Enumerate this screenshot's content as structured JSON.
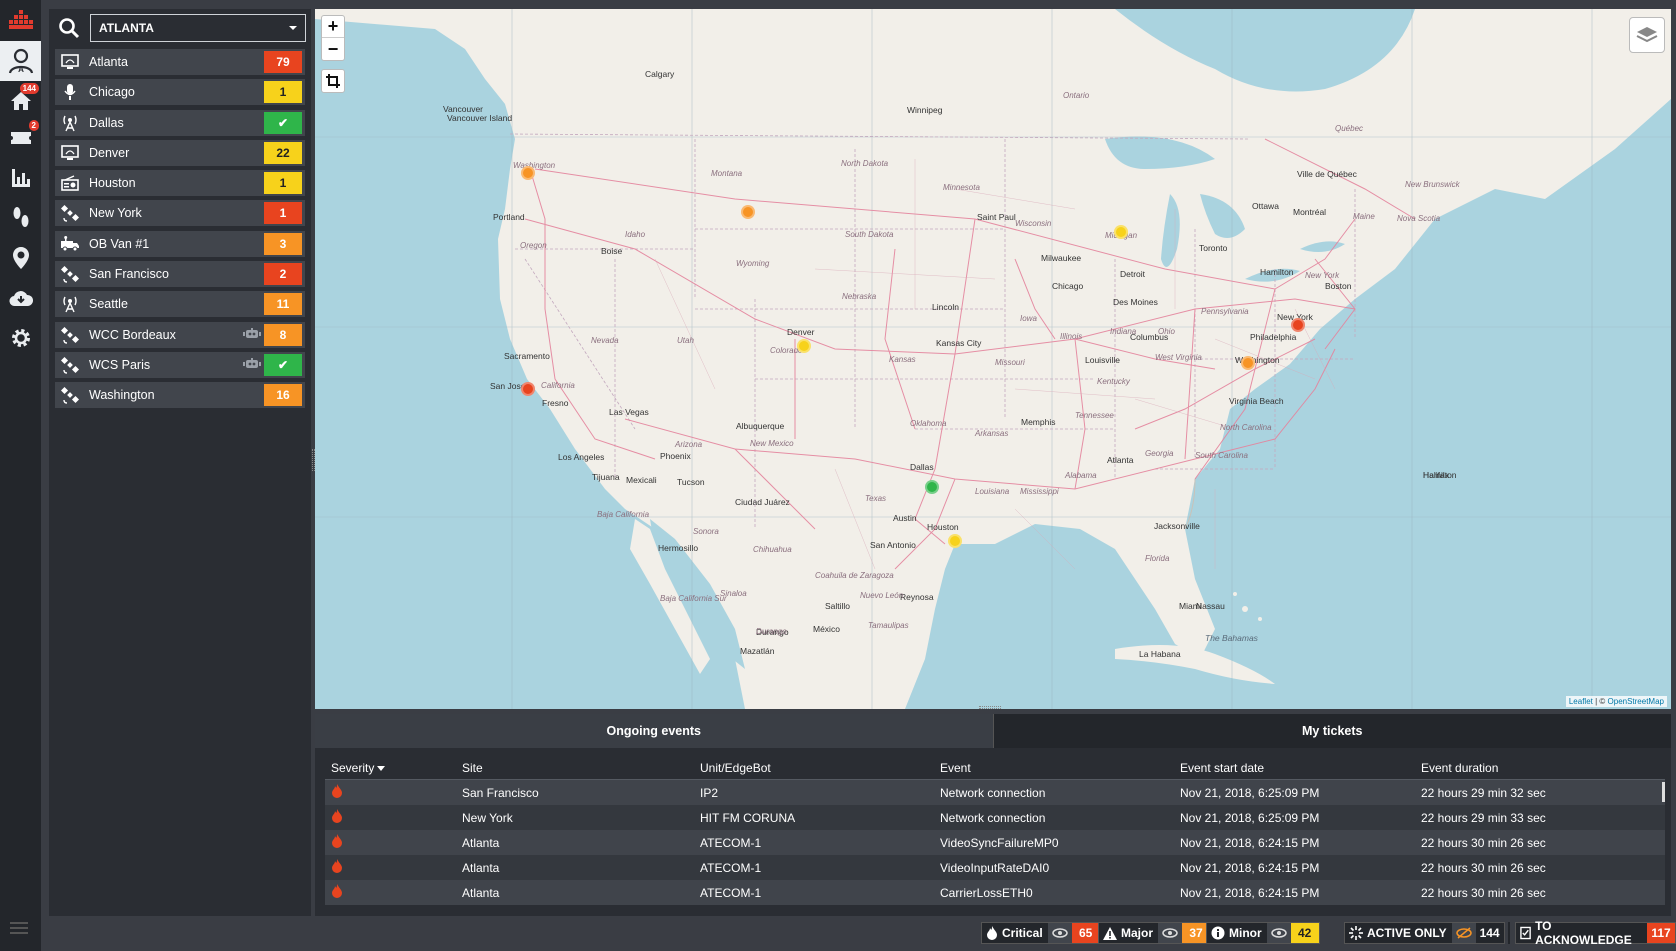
{
  "nav": {
    "items": [
      {
        "icon": "logo-icon"
      },
      {
        "icon": "user-icon"
      },
      {
        "icon": "home-icon",
        "badge": "144"
      },
      {
        "icon": "ticket-icon",
        "badge": "2"
      },
      {
        "icon": "bar-chart-icon"
      },
      {
        "icon": "footsteps-icon"
      },
      {
        "icon": "location-pin-icon"
      },
      {
        "icon": "cloud-download-icon"
      },
      {
        "icon": "gear-icon"
      }
    ]
  },
  "site_panel": {
    "selected_site": "ATLANTA",
    "sites": [
      {
        "name": "Atlanta",
        "icon": "monitor-icon",
        "count": "79",
        "color": "#e8441f",
        "robot": false
      },
      {
        "name": "Chicago",
        "icon": "microphone-icon",
        "count": "1",
        "color": "#f7d21b",
        "robot": false
      },
      {
        "name": "Dallas",
        "icon": "antenna-icon",
        "count": "✔",
        "color": "#2fb54a",
        "robot": false
      },
      {
        "name": "Denver",
        "icon": "monitor-icon",
        "count": "22",
        "color": "#f7d21b",
        "robot": false
      },
      {
        "name": "Houston",
        "icon": "radio-icon",
        "count": "1",
        "color": "#f7d21b",
        "robot": false
      },
      {
        "name": "New York",
        "icon": "satellite-icon",
        "count": "1",
        "color": "#e8441f",
        "robot": false
      },
      {
        "name": "OB Van #1",
        "icon": "van-icon",
        "count": "3",
        "color": "#f79425",
        "robot": false
      },
      {
        "name": "San Francisco",
        "icon": "satellite-icon",
        "count": "2",
        "color": "#e8441f",
        "robot": false
      },
      {
        "name": "Seattle",
        "icon": "antenna-icon",
        "count": "11",
        "color": "#f79425",
        "robot": false
      },
      {
        "name": "WCC Bordeaux",
        "icon": "satellite-icon",
        "count": "8",
        "color": "#f79425",
        "robot": true
      },
      {
        "name": "WCS Paris",
        "icon": "satellite-icon",
        "count": "✔",
        "color": "#2fb54a",
        "robot": true
      },
      {
        "name": "Washington",
        "icon": "satellite-icon",
        "count": "16",
        "color": "#f79425",
        "robot": false
      }
    ]
  },
  "map": {
    "zoom_in": "+",
    "zoom_out": "−",
    "attribution_leaflet": "Leaflet",
    "attribution_sep": " | © ",
    "attribution_osm": "OpenStreetMap",
    "cities": [
      "Calgary",
      "Winnipeg",
      "Vancouver",
      "Vancouver Island",
      "Portland",
      "Boise",
      "Saint Paul",
      "Milwaukee",
      "Detroit",
      "Toronto",
      "Ottawa",
      "Montréal",
      "Ville de Québec",
      "Hamilton",
      "Chicago",
      "Des Moines",
      "Lincoln",
      "Kansas City",
      "Denver",
      "Sacramento",
      "San Jose",
      "Fresno",
      "Las Vegas",
      "Los Angeles",
      "Tijuana",
      "Mexicali",
      "Phoenix",
      "Tucson",
      "Albuquerque",
      "Ciudad Juárez",
      "Dallas",
      "Austin",
      "San Antonio",
      "Houston",
      "Memphis",
      "Atlanta",
      "Louisville",
      "Columbus",
      "Philadelphia",
      "New York",
      "Boston",
      "Washington",
      "Virginia Beach",
      "Jacksonville",
      "Miami",
      "Nassau",
      "Hermosillo",
      "Saltillo",
      "Reynosa",
      "Durango",
      "Mazatlán",
      "México",
      "La Habana",
      "Halifax",
      "Hamilton"
    ],
    "regions": [
      "Washington",
      "Montana",
      "North Dakota",
      "Minnesota",
      "Wisconsin",
      "South Dakota",
      "Wyoming",
      "Nebraska",
      "Oregon",
      "Idaho",
      "Nevada",
      "Utah",
      "Colorado",
      "Kansas",
      "Missouri",
      "Iowa",
      "Illinois",
      "Indiana",
      "Ohio",
      "Kentucky",
      "West Virginia",
      "Pennsylvania",
      "New York",
      "Maine",
      "New Brunswick",
      "Nova Scotia",
      "Ontario",
      "Québec",
      "California",
      "Arizona",
      "New Mexico",
      "Texas",
      "Oklahoma",
      "Arkansas",
      "Tennessee",
      "Alabama",
      "Louisiana",
      "Mississippi",
      "Georgia",
      "North Carolina",
      "South Carolina",
      "Florida",
      "Baja California",
      "Baja California Sur",
      "Sonora",
      "Chihuahua",
      "Coahuila de Zaragoza",
      "Nuevo León",
      "Tamaulipas",
      "Sinaloa",
      "Durango",
      "Michigan"
    ],
    "seas": [
      "The Bahamas"
    ],
    "markers": [
      {
        "site": "Seattle",
        "color": "#f79425"
      },
      {
        "site": "Montana",
        "color": "#f79425"
      },
      {
        "site": "Michigan",
        "color": "#f7d21b"
      },
      {
        "site": "New York",
        "color": "#e8441f"
      },
      {
        "site": "Washington",
        "color": "#f79425"
      },
      {
        "site": "Denver",
        "color": "#f7d21b"
      },
      {
        "site": "San Francisco",
        "color": "#e8441f"
      },
      {
        "site": "Dallas",
        "color": "#2fb54a"
      },
      {
        "site": "Houston",
        "color": "#f7d21b"
      }
    ]
  },
  "events": {
    "tabs": [
      {
        "label": "Ongoing events",
        "active": true
      },
      {
        "label": "My tickets",
        "active": false
      }
    ],
    "columns": [
      "Severity",
      "Site",
      "Unit/EdgeBot",
      "Event",
      "Event start date",
      "Event duration"
    ],
    "rows": [
      {
        "severity": "critical",
        "site": "San Francisco",
        "unit": "IP2",
        "event": "Network connection",
        "start": "Nov 21, 2018, 6:25:09 PM",
        "duration": "22 hours 29 min 32 sec"
      },
      {
        "severity": "critical",
        "site": "New York",
        "unit": "HIT FM CORUNA",
        "event": "Network connection",
        "start": "Nov 21, 2018, 6:25:09 PM",
        "duration": "22 hours 29 min 33 sec"
      },
      {
        "severity": "critical",
        "site": "Atlanta",
        "unit": "ATECOM-1",
        "event": "VideoSyncFailureMP0",
        "start": "Nov 21, 2018, 6:24:15 PM",
        "duration": "22 hours 30 min 26 sec"
      },
      {
        "severity": "critical",
        "site": "Atlanta",
        "unit": "ATECOM-1",
        "event": "VideoInputRateDAI0",
        "start": "Nov 21, 2018, 6:24:15 PM",
        "duration": "22 hours 30 min 26 sec"
      },
      {
        "severity": "critical",
        "site": "Atlanta",
        "unit": "ATECOM-1",
        "event": "CarrierLossETH0",
        "start": "Nov 21, 2018, 6:24:15 PM",
        "duration": "22 hours 30 min 26 sec"
      }
    ]
  },
  "statusbar": {
    "critical": {
      "label": "Critical",
      "count": "65",
      "color": "#e8441f"
    },
    "major": {
      "label": "Major",
      "count": "37",
      "color": "#f79425"
    },
    "minor": {
      "label": "Minor",
      "count": "42",
      "color": "#f7d21b"
    },
    "active_only": {
      "label": "ACTIVE ONLY",
      "count": "144"
    },
    "to_ack": {
      "label": "TO ACKNOWLEDGE",
      "count": "117",
      "color": "#e8441f"
    }
  }
}
